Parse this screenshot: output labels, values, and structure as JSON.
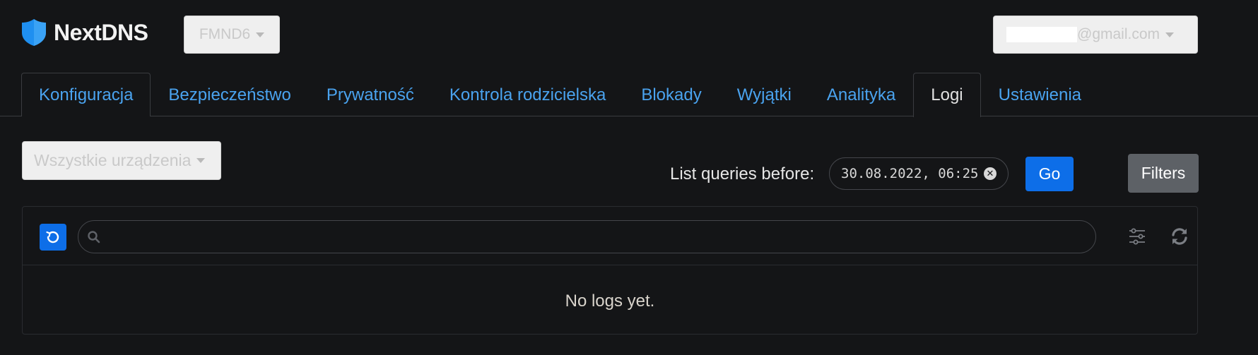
{
  "header": {
    "logo_text": "NextDNS",
    "profile_label": "FMND6",
    "account_label": "@gmail.com"
  },
  "tabs": [
    {
      "label": "Konfiguracja"
    },
    {
      "label": "Bezpieczeństwo"
    },
    {
      "label": "Prywatność"
    },
    {
      "label": "Kontrola rodzicielska"
    },
    {
      "label": "Blokady"
    },
    {
      "label": "Wyjątki"
    },
    {
      "label": "Analityka"
    },
    {
      "label": "Logi",
      "selected": true
    },
    {
      "label": "Ustawienia"
    }
  ],
  "toolbar": {
    "device_label": "Wszystkie urządzenia",
    "before_label": "List queries before:",
    "date_value": "30.08.2022, 06:25",
    "go_label": "Go",
    "filters_label": "Filters"
  },
  "logs": {
    "search_placeholder": "",
    "empty_message": "No logs yet."
  },
  "colors": {
    "background": "#141517",
    "link": "#4aa3ef",
    "primary": "#0d6ee8",
    "secondary": "#5d6166",
    "logo_shield": "#1f8ff0"
  },
  "icons": {
    "logo": "shield-icon",
    "live": "history-icon",
    "search": "search-icon",
    "settings": "sliders-icon",
    "refresh": "refresh-icon",
    "clear": "clear-icon",
    "dropdown": "caret-down-icon"
  }
}
